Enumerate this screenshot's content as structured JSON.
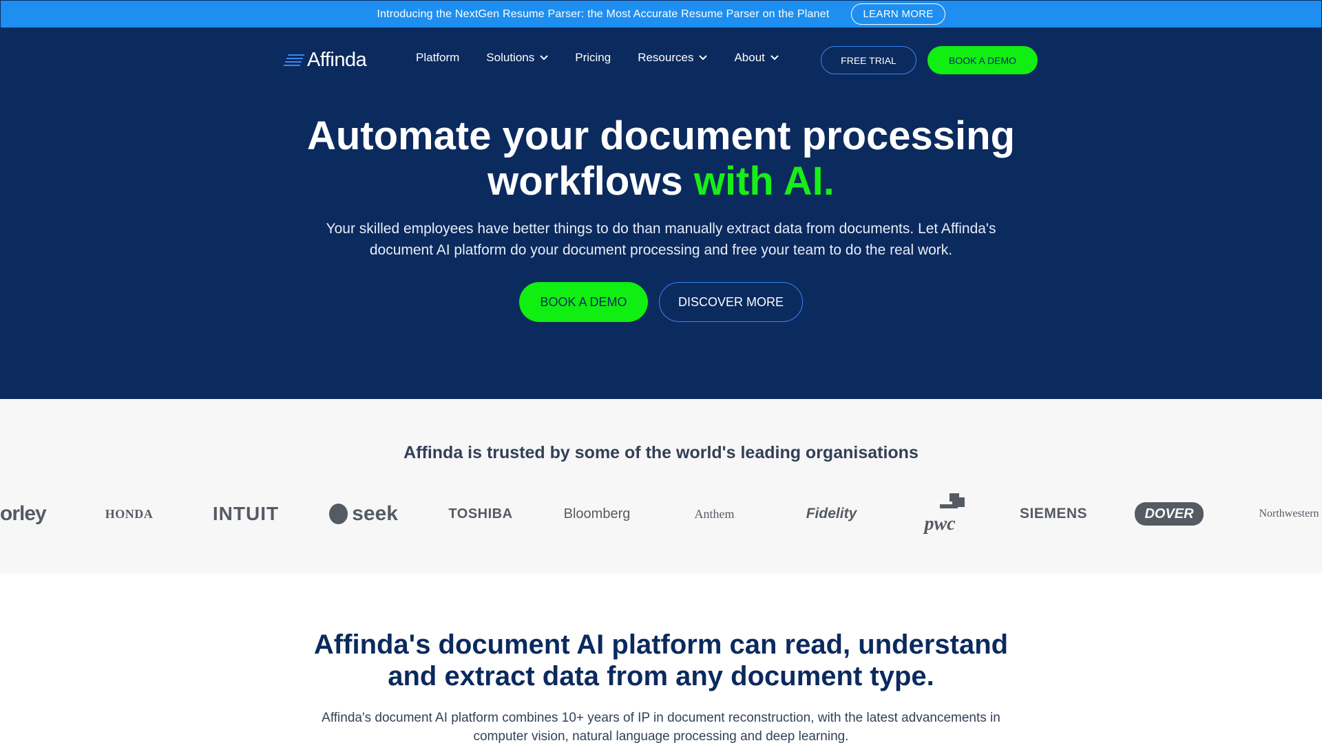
{
  "announcement": {
    "text": "Introducing the NextGen Resume Parser: the Most Accurate Resume Parser on the Planet",
    "button": "LEARN MORE"
  },
  "nav": {
    "logo_text": "Affinda",
    "links": [
      {
        "label": "Platform",
        "dropdown": false
      },
      {
        "label": "Solutions",
        "dropdown": true
      },
      {
        "label": "Pricing",
        "dropdown": false
      },
      {
        "label": "Resources",
        "dropdown": true
      },
      {
        "label": "About",
        "dropdown": true
      }
    ],
    "free_trial": "FREE TRIAL",
    "book_demo": "BOOK A DEMO"
  },
  "hero": {
    "title_line1": "Automate your document processing",
    "title_line2_main": "workflows ",
    "title_line2_accent": "with AI.",
    "subtitle": "Your skilled employees have better things to do than manually extract data from documents. Let Affinda's document AI platform do your document processing and free your team to do the real work.",
    "book_demo": "BOOK A DEMO",
    "discover_more": "DISCOVER MORE"
  },
  "trusted": {
    "title": "Affinda is trusted by some of the world's leading organisations",
    "logos": [
      "orley",
      "HONDA",
      "INTUIT",
      "seek",
      "TOSHIBA",
      "Bloomberg",
      "Anthem",
      "Fidelity",
      "pwc",
      "SIEMENS",
      "DOVER",
      "Northwestern"
    ]
  },
  "platform": {
    "title_line1": "Affinda's document AI platform can read, understand",
    "title_line2": "and extract data from any document type.",
    "subtitle": "Affinda's document AI platform combines 10+ years of IP in document reconstruction, with the latest advancements in computer vision, natural language processing and deep learning."
  },
  "colors": {
    "announcement_bg": "#1e8ff0",
    "hero_bg": "#0b2a5e",
    "accent_green": "#11ee11",
    "trusted_bg": "#f7f7f8"
  }
}
